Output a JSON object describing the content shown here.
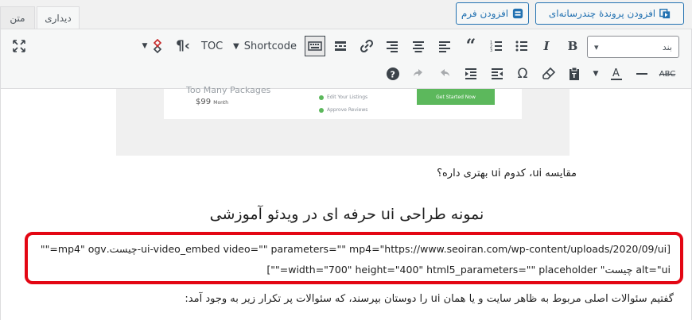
{
  "header": {
    "add_media": "افزودن پروندهٔ چندرسانه‌ای",
    "add_form": "افزودن فرم"
  },
  "tabs": {
    "visual": "دیداری",
    "text": "متن"
  },
  "toolbar": {
    "format_select": "بند",
    "shortcode_label": "Shortcode",
    "toc_label": "TOC"
  },
  "content": {
    "image_text": {
      "packages_title": "Too Many Packages",
      "price": "$99",
      "price_suffix": "Month",
      "list_item_1": "Edit Your Listings",
      "list_item_2": "Approve Reviews",
      "cta": "Get Started Now"
    },
    "paragraph_1": "مقایسه ui، کدوم ui بهتری داره؟",
    "heading": "نمونه طراحی ui حرفه ای در ویدئو آموزشی",
    "shortcode_line_1": "[ui-video_embed video=\"\" parameters=\"\" mp4=\"https://www.seoiran.com/wp-content/uploads/2020/09/ui-چیست.mp4\" ogv=\"\"",
    "shortcode_line_2": "alt=\"ui چیست\" width=\"700\" height=\"400\" html5_parameters=\"\" placeholder=\"\"]",
    "paragraph_2": "گفتیم سئوالات اصلی مربوط به ظاهر سایت و یا همان ui را دوستان بپرسند، که سئوالات پر تکرار زیر به وجود آمد:"
  },
  "colors": {
    "accent": "#2271b1",
    "highlight_border": "#e30613"
  }
}
